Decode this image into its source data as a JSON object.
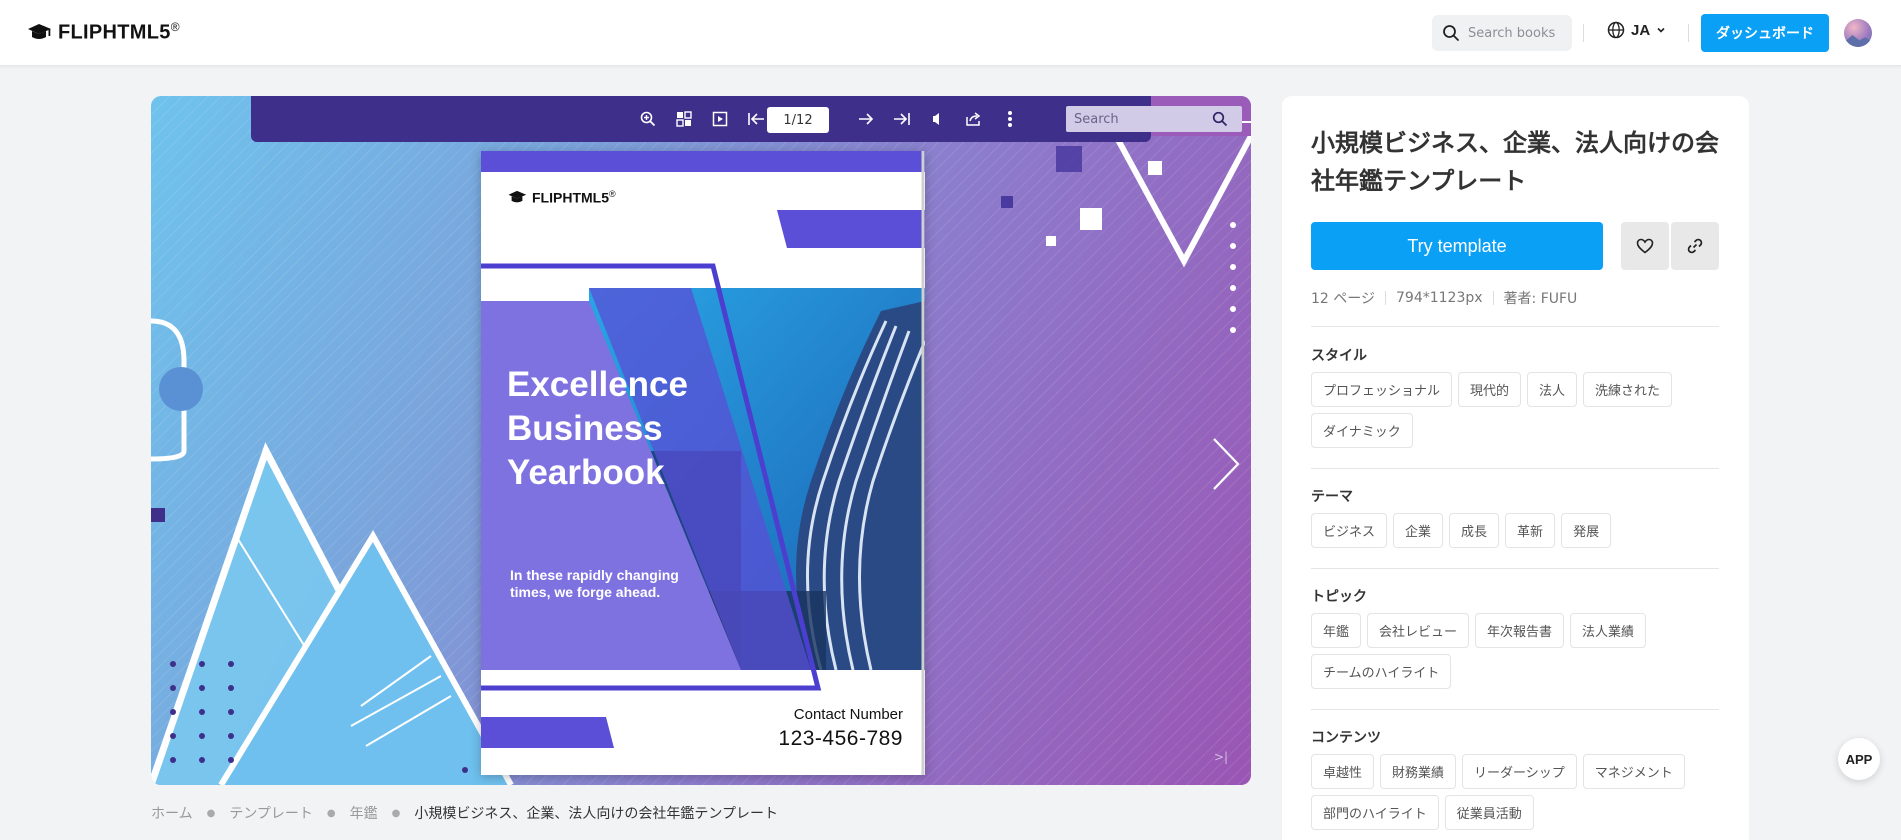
{
  "header": {
    "logo_text": "FLIPHTML5",
    "logo_reg": "®",
    "search_placeholder": "Search books",
    "language": "JA",
    "dashboard_label": "ダッシュボード"
  },
  "viewer": {
    "page_indicator": "1/12",
    "search_placeholder": "Search",
    "book": {
      "logo_text": "FLIPHTML5",
      "logo_reg": "®",
      "title_line1": "Excellence",
      "title_line2": "Business",
      "title_line3": "Yearbook",
      "subtitle_line1": "In these rapidly changing",
      "subtitle_line2": "times, we forge ahead.",
      "contact_label": "Contact Number",
      "contact_number": "123-456-789"
    },
    "end_mark": ">|"
  },
  "breadcrumb": {
    "items": [
      "ホーム",
      "テンプレート",
      "年鑑"
    ],
    "current": "小規模ビジネス、企業、法人向けの会社年鑑テンプレート"
  },
  "panel": {
    "title": "小規模ビジネス、企業、法人向けの会社年鑑テンプレート",
    "try_label": "Try template",
    "meta": {
      "pages": "12 ページ",
      "size": "794*1123px",
      "author": "著者: FUFU"
    },
    "sections": [
      {
        "title": "スタイル",
        "tags": [
          "プロフェッショナル",
          "現代的",
          "法人",
          "洗練された",
          "ダイナミック"
        ]
      },
      {
        "title": "テーマ",
        "tags": [
          "ビジネス",
          "企業",
          "成長",
          "革新",
          "発展"
        ]
      },
      {
        "title": "トピック",
        "tags": [
          "年鑑",
          "会社レビュー",
          "年次報告書",
          "法人業績",
          "チームのハイライト"
        ]
      },
      {
        "title": "コンテンツ",
        "tags": [
          "卓越性",
          "財務業績",
          "リーダーシップ",
          "マネジメント",
          "部門のハイライト",
          "従業員活動"
        ]
      }
    ]
  },
  "app_label": "APP",
  "colors": {
    "accent": "#0aa0f5",
    "toolbar": "#3e2f8a",
    "book_blue": "#5a4fd6"
  }
}
